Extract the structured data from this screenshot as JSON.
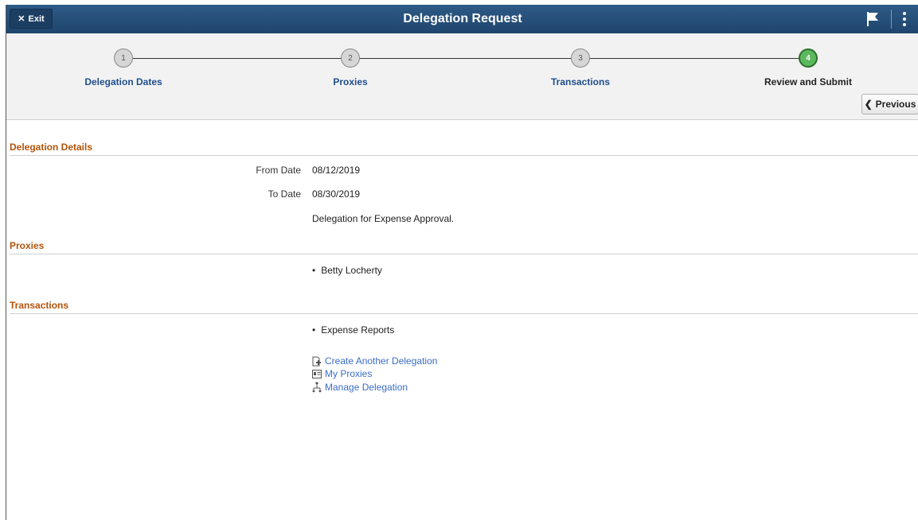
{
  "header": {
    "exit_label": "Exit",
    "title": "Delegation Request",
    "flag_icon": "flag-icon",
    "actions_icon": "kebab-menu-icon",
    "background": "#2d5a86"
  },
  "train": {
    "steps": [
      {
        "number": "1",
        "label": "Delegation Dates"
      },
      {
        "number": "2",
        "label": "Proxies"
      },
      {
        "number": "3",
        "label": "Transactions"
      },
      {
        "number": "4",
        "label": "Review and Submit"
      }
    ],
    "active_step": 4,
    "active_color": "#5cb85c",
    "previous_label": "Previous"
  },
  "details": {
    "heading": "Delegation Details",
    "from_label": "From Date",
    "from_value": "08/12/2019",
    "to_label": "To Date",
    "to_value": "08/30/2019",
    "comment": "Delegation for Expense Approval."
  },
  "proxies": {
    "heading": "Proxies",
    "items": [
      "Betty Locherty"
    ]
  },
  "transactions": {
    "heading": "Transactions",
    "items": [
      "Expense Reports"
    ]
  },
  "links": {
    "create": "Create Another Delegation",
    "my_proxies": "My Proxies",
    "manage": "Manage Delegation"
  },
  "colors": {
    "section_heading": "#b45309",
    "link": "#3b6dc9"
  }
}
